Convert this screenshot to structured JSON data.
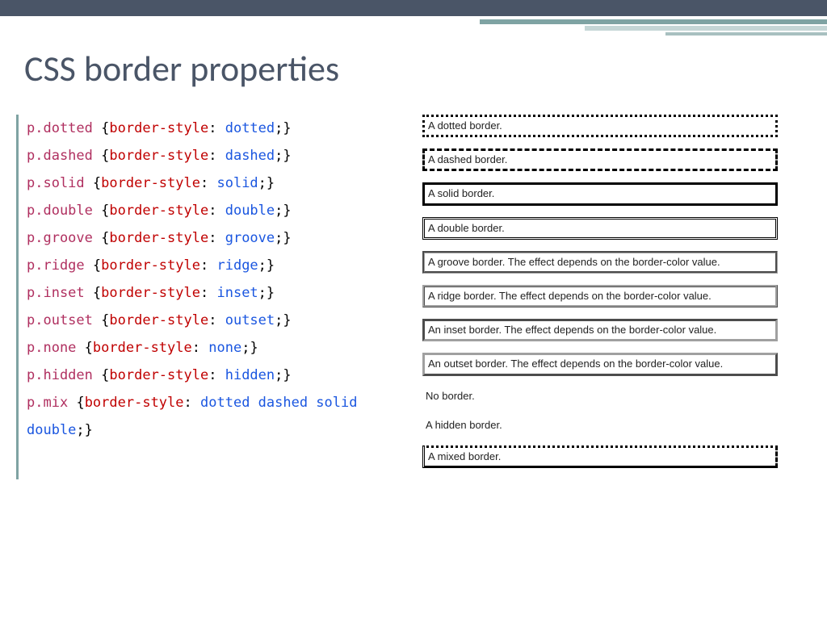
{
  "title": "CSS border properties",
  "code": [
    {
      "sel": "p.dotted",
      "prop": "border-style",
      "val": "dotted"
    },
    {
      "sel": "p.dashed",
      "prop": "border-style",
      "val": "dashed"
    },
    {
      "sel": "p.solid",
      "prop": "border-style",
      "val": "solid"
    },
    {
      "sel": "p.double",
      "prop": "border-style",
      "val": "double"
    },
    {
      "sel": "p.groove",
      "prop": "border-style",
      "val": "groove"
    },
    {
      "sel": "p.ridge",
      "prop": "border-style",
      "val": "ridge"
    },
    {
      "sel": "p.inset",
      "prop": "border-style",
      "val": "inset"
    },
    {
      "sel": "p.outset",
      "prop": "border-style",
      "val": "outset"
    },
    {
      "sel": "p.none",
      "prop": "border-style",
      "val": "none"
    },
    {
      "sel": "p.hidden",
      "prop": "border-style",
      "val": "hidden"
    },
    {
      "sel": "p.mix",
      "prop": "border-style",
      "val": "dotted dashed solid double"
    }
  ],
  "demos": {
    "dotted": "A dotted border.",
    "dashed": "A dashed border.",
    "solid": "A solid border.",
    "double": "A double border.",
    "groove": "A groove border. The effect depends on the border-color value.",
    "ridge": "A ridge border. The effect depends on the border-color value.",
    "inset": "An inset border. The effect depends on the border-color value.",
    "outset": "An outset border. The effect depends on the border-color value.",
    "none": "No border.",
    "hidden": "A hidden border.",
    "mix": "A mixed border."
  }
}
